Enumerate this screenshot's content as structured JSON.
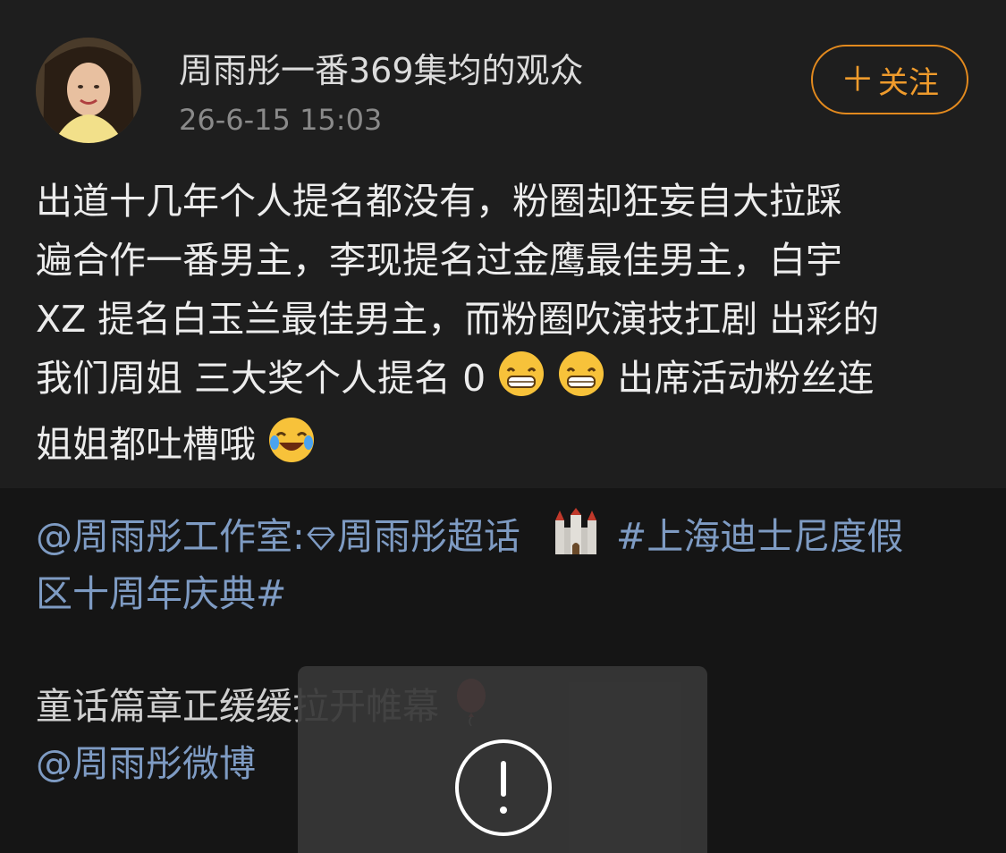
{
  "post": {
    "username": "周雨彤一番369集均的观众",
    "timestamp": "26-6-15 15:03",
    "follow_label": "关注",
    "body_lines": [
      "出道十几年个人提名都没有，粉圈却狂妄自大拉踩",
      "遍合作一番男主，李现提名过金鹰最佳男主，白宇",
      "XZ 提名白玉兰最佳男主，而粉圈吹演技扛剧 出彩的",
      "我们周姐 三大奖个人提名 0",
      "出席活动粉丝连",
      "姐姐都吐槽哦"
    ]
  },
  "repost": {
    "mention_studio": "@周雨彤工作室:",
    "supertopic": "周雨彤超话",
    "hashtag_part1": "#上海迪士尼度假",
    "hashtag_part2": "区十周年庆典#",
    "caption": "童话篇章正缓缓拉开帷幕",
    "mention_weibo": "@周雨彤微博"
  },
  "icons": {
    "avatar": "avatar-photo",
    "grin": "grinning-face-emoji",
    "laugh": "tears-of-joy-emoji",
    "castle": "castle-emoji",
    "balloon": "balloon-emoji",
    "supertopic": "diamond-icon",
    "alert": "exclamation-circle-icon"
  },
  "colors": {
    "accent": "#ef9b2c",
    "link": "#7e9bc3",
    "background": "#1e1e1e"
  }
}
